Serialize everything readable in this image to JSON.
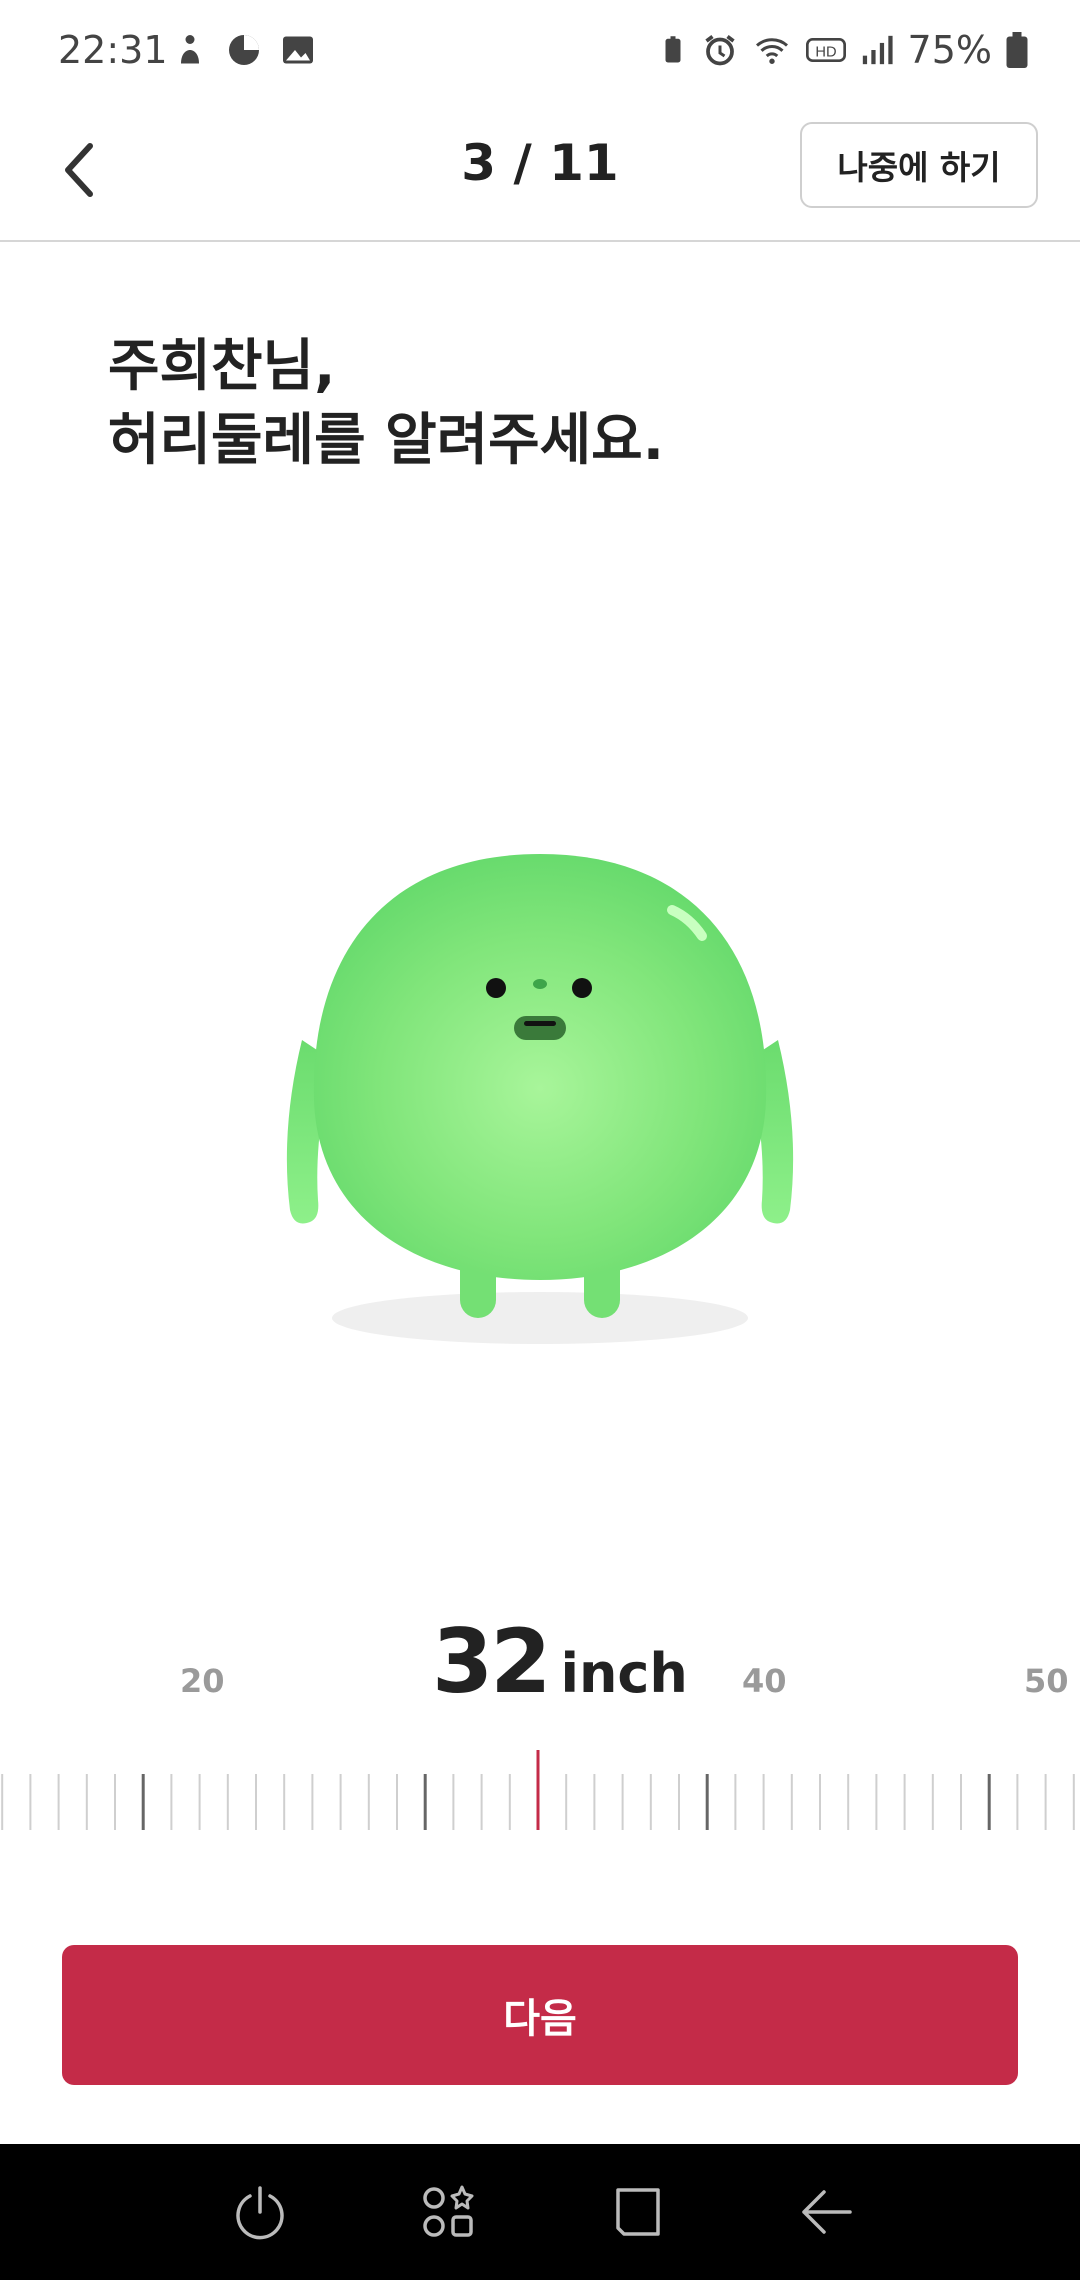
{
  "status_bar": {
    "time": "22:31",
    "battery_percent": "75%"
  },
  "header": {
    "page_counter": "3 / 11",
    "later_label": "나중에 하기"
  },
  "question": {
    "line1": "주희찬님,",
    "line2": "허리둘레를 알려주세요."
  },
  "selector": {
    "value": "32",
    "unit": "inch",
    "tick_labels": [
      "20",
      "40",
      "50"
    ]
  },
  "actions": {
    "next_label": "다음"
  },
  "colors": {
    "accent": "#c42b48",
    "character": "#6fdc6f"
  }
}
